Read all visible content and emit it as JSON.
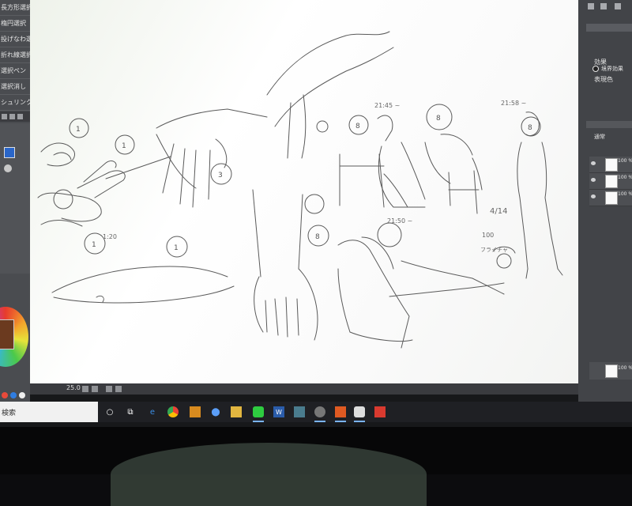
{
  "left_panel": {
    "tools": [
      "長方形選択",
      "楕円選択",
      "投げなわ選択",
      "折れ線選択",
      "選択ペン",
      "選択消し",
      "シュリンク選択"
    ]
  },
  "canvas": {
    "zoom": "25.0",
    "annotations": {
      "time_1": "21:45 ~",
      "time_2": "21:58 ~",
      "time_3": "21:50 ~",
      "time_4": "1:20",
      "date": "4/14",
      "count": "100",
      "kanji": "フライチャ"
    }
  },
  "right_panel": {
    "effect_label": "効果",
    "effect_value": "境界効果",
    "display_label": "表現色",
    "mode_label": "通常",
    "layers": [
      {
        "name": "100 %通常 レイヤー"
      },
      {
        "name": "100 %通常 レイヤー"
      },
      {
        "name": "100 %通常 用紙"
      }
    ],
    "bottom_layer": "100 %通常 レイヤー"
  },
  "taskbar": {
    "search_placeholder": "検索"
  },
  "icons": {
    "start": "start-icon",
    "taskview": "task-view-icon",
    "edge": "edge-icon",
    "chrome": "chrome-icon",
    "store": "store-icon",
    "explorer": "file-explorer-icon",
    "line": "line-app-icon",
    "word": "word-icon",
    "note": "note-icon",
    "clip": "clip-studio-icon",
    "app1": "app-icon",
    "app2": "app-icon",
    "app3": "app-icon"
  },
  "colors": {
    "panel": "#4a4c50",
    "taskbar": "#1f2024",
    "accent": "#7ab4ff"
  }
}
